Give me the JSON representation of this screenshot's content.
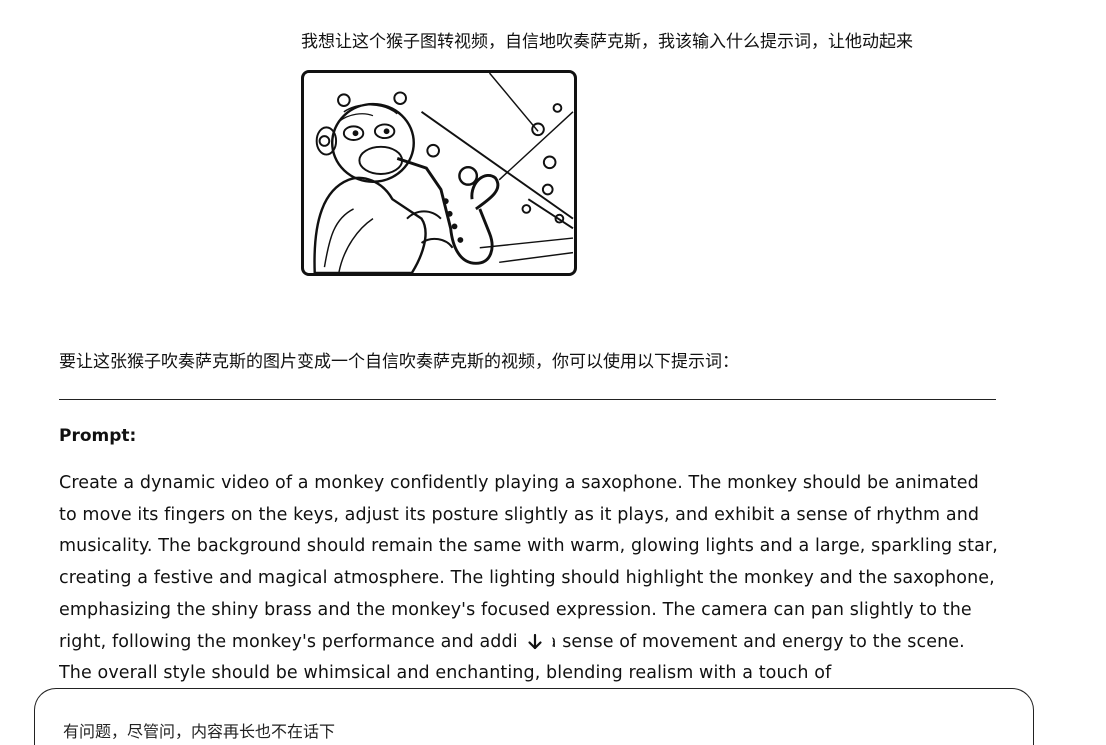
{
  "conversation": {
    "user_message": "我想让这个猴子图转视频，自信地吹奏萨克斯，我该输入什么提示词，让他动起来",
    "user_image_icon": "monkey-saxophone-illustration",
    "assistant_intro": "要让这张猴子吹奏萨克斯的图片变成一个自信吹奏萨克斯的视频，你可以使用以下提示词：",
    "prompt_heading": "Prompt:",
    "prompt_text": "Create a dynamic video of a monkey confidently playing a saxophone. The monkey should be animated to move its fingers on the keys, adjust its posture slightly as it plays, and exhibit a sense of rhythm and musicality. The background should remain the same with warm, glowing lights and a large, sparkling star, creating a festive and magical atmosphere. The lighting should highlight the monkey and the saxophone, emphasizing the shiny brass and the monkey's focused expression. The camera can pan slightly to the right, following the monkey's performance and adding a sense of movement and energy to the scene. The overall style should be whimsical and enchanting, blending realism with a touch of"
  },
  "scroll_button": {
    "icon": "arrow-down-icon"
  },
  "composer": {
    "placeholder": "有问题，尽管问，内容再长也不在话下"
  }
}
